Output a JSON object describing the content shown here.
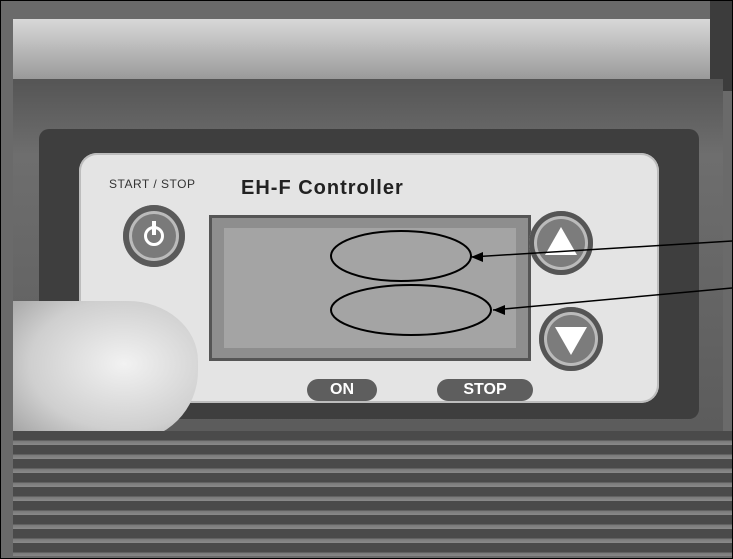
{
  "panel": {
    "start_stop_label": "START / STOP",
    "title": "EH-F Controller",
    "on_indicator": "ON",
    "stop_indicator": "STOP"
  },
  "annotations": {
    "ellipse_count": 2,
    "leader_lines": 2
  },
  "colors": {
    "panel_bg": "#e4e4e4",
    "housing": "#5a5a5a",
    "lcd": "#8e8e8e"
  }
}
